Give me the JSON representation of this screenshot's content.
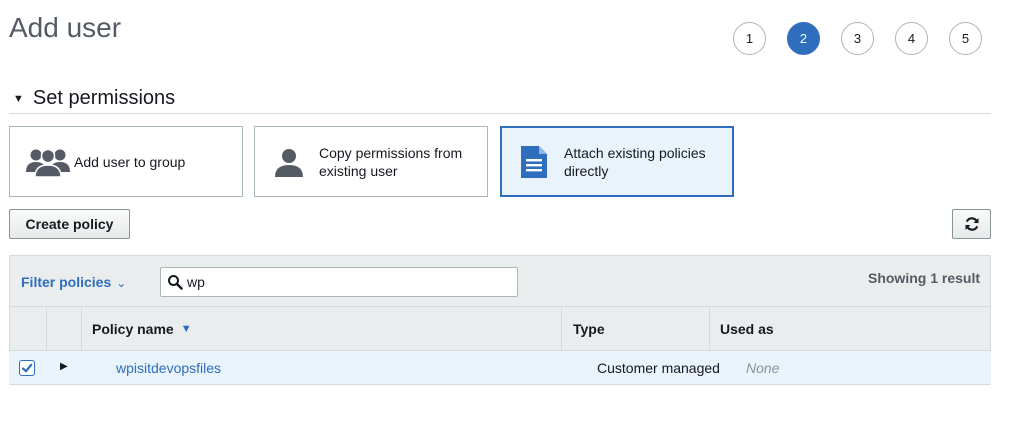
{
  "page": {
    "title": "Add user"
  },
  "steps": [
    "1",
    "2",
    "3",
    "4",
    "5"
  ],
  "active_step": "2",
  "section": {
    "title": "Set permissions",
    "caret_icon": "caret-down-icon"
  },
  "options": {
    "add_to_group": {
      "label": "Add user to group",
      "icon": "users-group-icon"
    },
    "copy_permissions": {
      "label_line1": "Copy permissions from",
      "label_line2": "existing user",
      "icon": "user-icon"
    },
    "attach_policies": {
      "label_line1": "Attach existing policies",
      "label_line2": "directly",
      "icon": "document-icon",
      "selected": true
    }
  },
  "toolbar": {
    "create_policy_label": "Create policy",
    "refresh_icon": "refresh-icon"
  },
  "filter": {
    "label": "Filter policies",
    "search_value": "wp",
    "result_count": "Showing 1 result"
  },
  "table": {
    "columns": {
      "policy_name": "Policy name",
      "type": "Type",
      "used_as": "Used as"
    },
    "rows": [
      {
        "checked": true,
        "policy_name": "wpisitdevopsfiles",
        "type": "Customer managed",
        "used_as": "None"
      }
    ]
  },
  "colors": {
    "accent": "#2f6ebc",
    "selected_bg": "#e9f3fb",
    "header_bg": "#eaeded",
    "border": "#d5dbdb"
  }
}
